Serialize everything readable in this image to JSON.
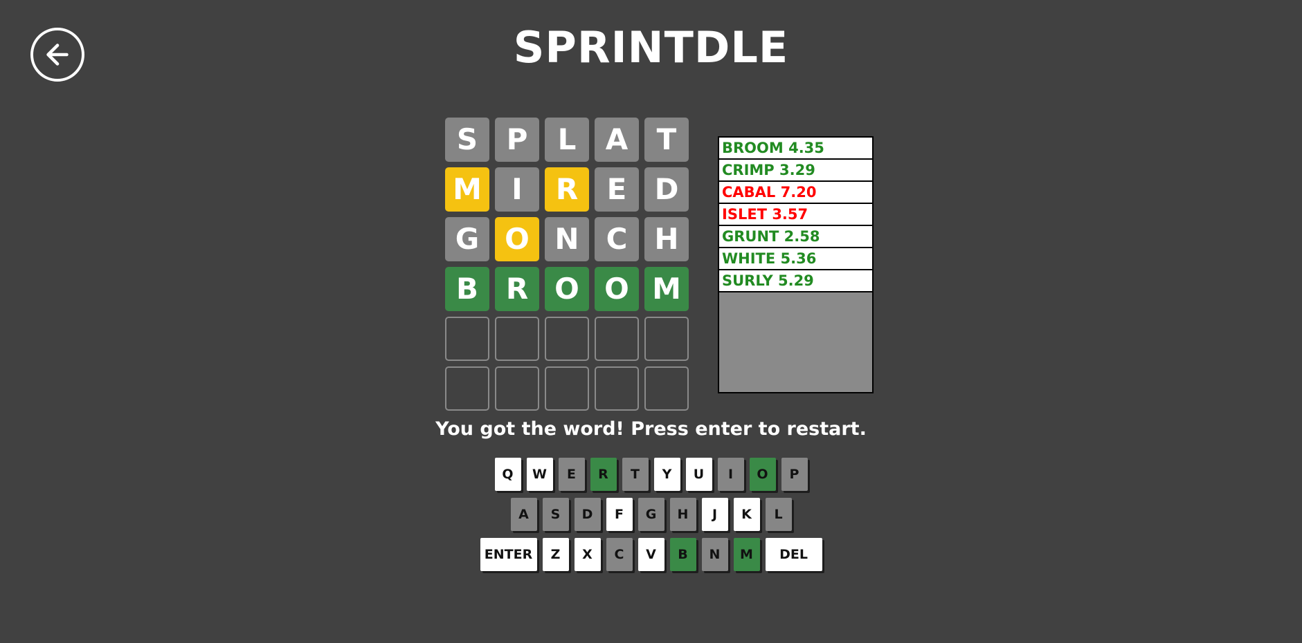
{
  "app": {
    "title": "SPRINTDLE",
    "background_color": "#414141"
  },
  "back_button": {
    "name": "back-arrow",
    "label": "Back"
  },
  "board": {
    "rows": [
      {
        "letters": [
          "S",
          "P",
          "L",
          "A",
          "T"
        ],
        "states": [
          "absent",
          "absent",
          "absent",
          "absent",
          "absent"
        ]
      },
      {
        "letters": [
          "M",
          "I",
          "R",
          "E",
          "D"
        ],
        "states": [
          "present",
          "absent",
          "present",
          "absent",
          "absent"
        ]
      },
      {
        "letters": [
          "G",
          "O",
          "N",
          "C",
          "H"
        ],
        "states": [
          "absent",
          "present",
          "absent",
          "absent",
          "absent"
        ]
      },
      {
        "letters": [
          "B",
          "R",
          "O",
          "O",
          "M"
        ],
        "states": [
          "correct",
          "correct",
          "correct",
          "correct",
          "correct"
        ]
      },
      {
        "letters": [
          "",
          "",
          "",
          "",
          ""
        ],
        "states": [
          "empty",
          "empty",
          "empty",
          "empty",
          "empty"
        ]
      },
      {
        "letters": [
          "",
          "",
          "",
          "",
          ""
        ],
        "states": [
          "empty",
          "empty",
          "empty",
          "empty",
          "empty"
        ]
      }
    ]
  },
  "scores": {
    "entries": [
      {
        "word": "BROOM",
        "time": "4.35",
        "result": "win"
      },
      {
        "word": "CRIMP",
        "time": "3.29",
        "result": "win"
      },
      {
        "word": "CABAL",
        "time": "7.20",
        "result": "loss"
      },
      {
        "word": "ISLET",
        "time": "3.57",
        "result": "loss"
      },
      {
        "word": "GRUNT",
        "time": "2.58",
        "result": "win"
      },
      {
        "word": "WHITE",
        "time": "5.36",
        "result": "win"
      },
      {
        "word": "SURLY",
        "time": "5.29",
        "result": "win"
      }
    ],
    "win_color": "#228b22",
    "loss_color": "#ff0000"
  },
  "status": {
    "message": "You got the word! Press enter to restart."
  },
  "keyboard": {
    "rows": [
      [
        {
          "label": "Q",
          "state": "unused"
        },
        {
          "label": "W",
          "state": "unused"
        },
        {
          "label": "E",
          "state": "absent"
        },
        {
          "label": "R",
          "state": "correct"
        },
        {
          "label": "T",
          "state": "absent"
        },
        {
          "label": "Y",
          "state": "unused"
        },
        {
          "label": "U",
          "state": "unused"
        },
        {
          "label": "I",
          "state": "absent"
        },
        {
          "label": "O",
          "state": "correct"
        },
        {
          "label": "P",
          "state": "absent"
        }
      ],
      [
        {
          "label": "A",
          "state": "absent"
        },
        {
          "label": "S",
          "state": "absent"
        },
        {
          "label": "D",
          "state": "absent"
        },
        {
          "label": "F",
          "state": "unused"
        },
        {
          "label": "G",
          "state": "absent"
        },
        {
          "label": "H",
          "state": "absent"
        },
        {
          "label": "J",
          "state": "unused"
        },
        {
          "label": "K",
          "state": "unused"
        },
        {
          "label": "L",
          "state": "absent"
        }
      ],
      [
        {
          "label": "ENTER",
          "state": "unused",
          "wide": true
        },
        {
          "label": "Z",
          "state": "unused"
        },
        {
          "label": "X",
          "state": "unused"
        },
        {
          "label": "C",
          "state": "absent"
        },
        {
          "label": "V",
          "state": "unused"
        },
        {
          "label": "B",
          "state": "correct"
        },
        {
          "label": "N",
          "state": "absent"
        },
        {
          "label": "M",
          "state": "correct"
        },
        {
          "label": "DEL",
          "state": "unused",
          "wide": true
        }
      ]
    ]
  }
}
